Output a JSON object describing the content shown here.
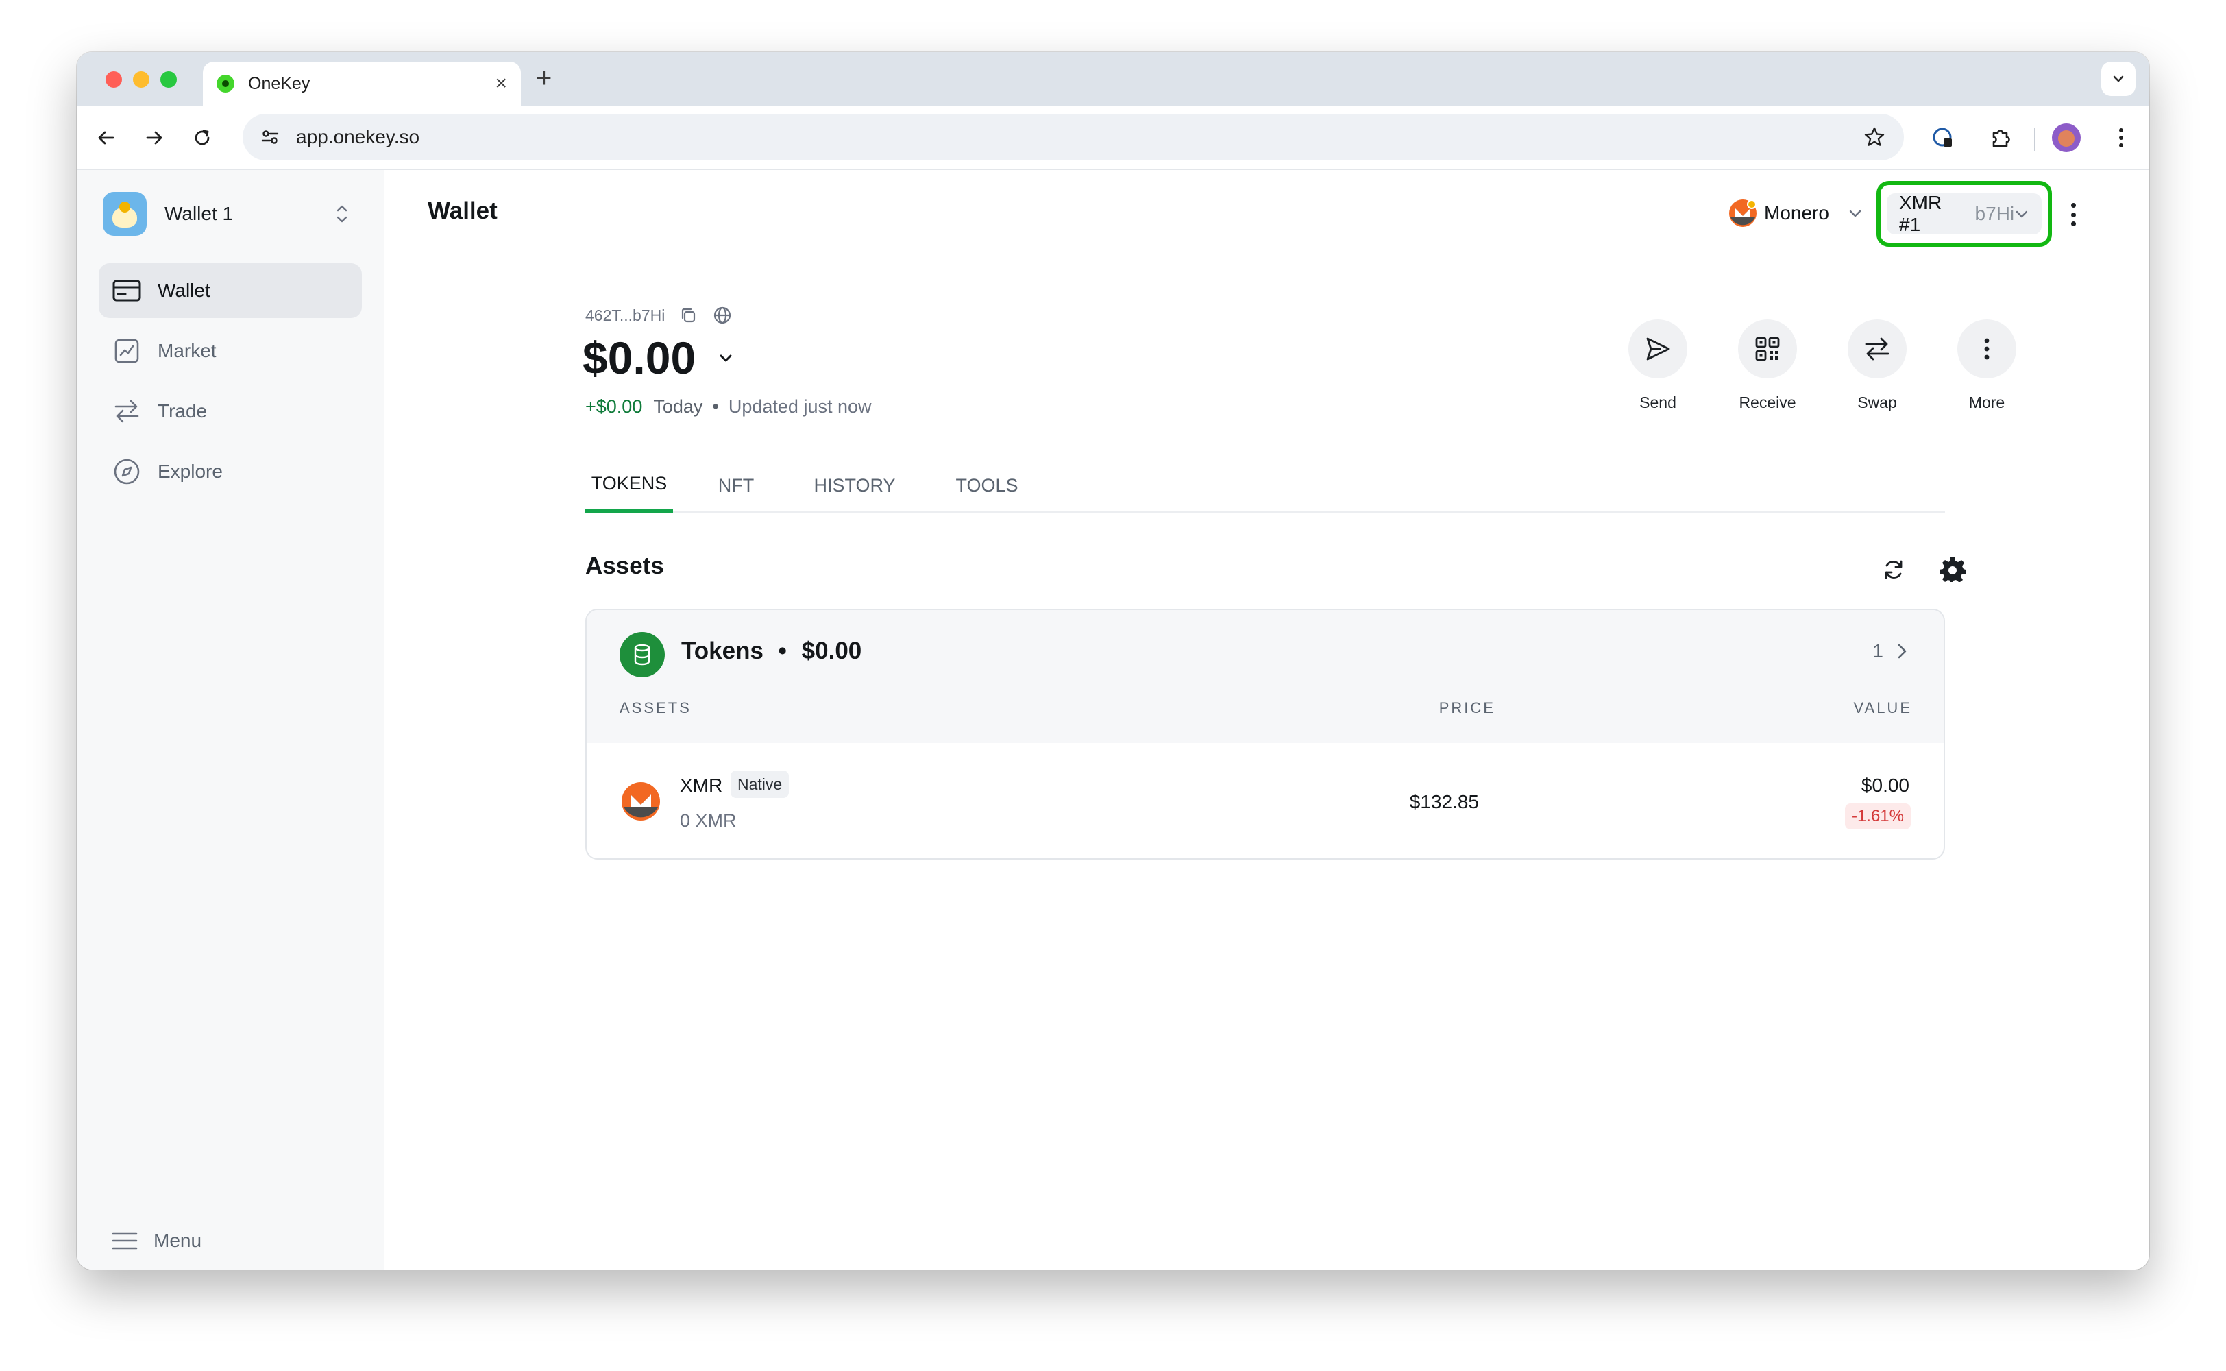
{
  "browser": {
    "tab_title": "OneKey",
    "url": "app.onekey.so"
  },
  "sidebar": {
    "wallet_name": "Wallet 1",
    "items": [
      {
        "label": "Wallet",
        "icon": "wallet-icon",
        "active": true
      },
      {
        "label": "Market",
        "icon": "chart-icon",
        "active": false
      },
      {
        "label": "Trade",
        "icon": "swap-arrows-icon",
        "active": false
      },
      {
        "label": "Explore",
        "icon": "compass-icon",
        "active": false
      }
    ],
    "menu_label": "Menu"
  },
  "header": {
    "title": "Wallet",
    "network_name": "Monero",
    "account_name": "XMR #1",
    "account_suffix": "b7Hi"
  },
  "balance": {
    "address": "462T...b7Hi",
    "total": "$0.00",
    "change_value": "+$0.00",
    "change_period": "Today",
    "separator": "•",
    "updated": "Updated just now"
  },
  "actions": [
    {
      "label": "Send",
      "icon": "send-icon"
    },
    {
      "label": "Receive",
      "icon": "qr-code-icon"
    },
    {
      "label": "Swap",
      "icon": "swap-icon"
    },
    {
      "label": "More",
      "icon": "more-vertical-icon"
    }
  ],
  "tabs": [
    {
      "label": "TOKENS",
      "active": true
    },
    {
      "label": "NFT",
      "active": false
    },
    {
      "label": "HISTORY",
      "active": false
    },
    {
      "label": "TOOLS",
      "active": false
    }
  ],
  "assets": {
    "title": "Assets",
    "card_title": "Tokens",
    "card_separator": "•",
    "card_total": "$0.00",
    "count": "1",
    "columns": {
      "assets": "ASSETS",
      "price": "PRICE",
      "value": "VALUE"
    },
    "rows": [
      {
        "symbol": "XMR",
        "badge": "Native",
        "balance": "0 XMR",
        "price": "$132.85",
        "value": "$0.00",
        "change": "-1.61%"
      }
    ]
  },
  "colors": {
    "accent_green": "#13a64b",
    "highlight_box": "#12b812",
    "negative": "#d43a3a",
    "positive": "#0f7b3a",
    "monero_orange": "#f26822"
  }
}
